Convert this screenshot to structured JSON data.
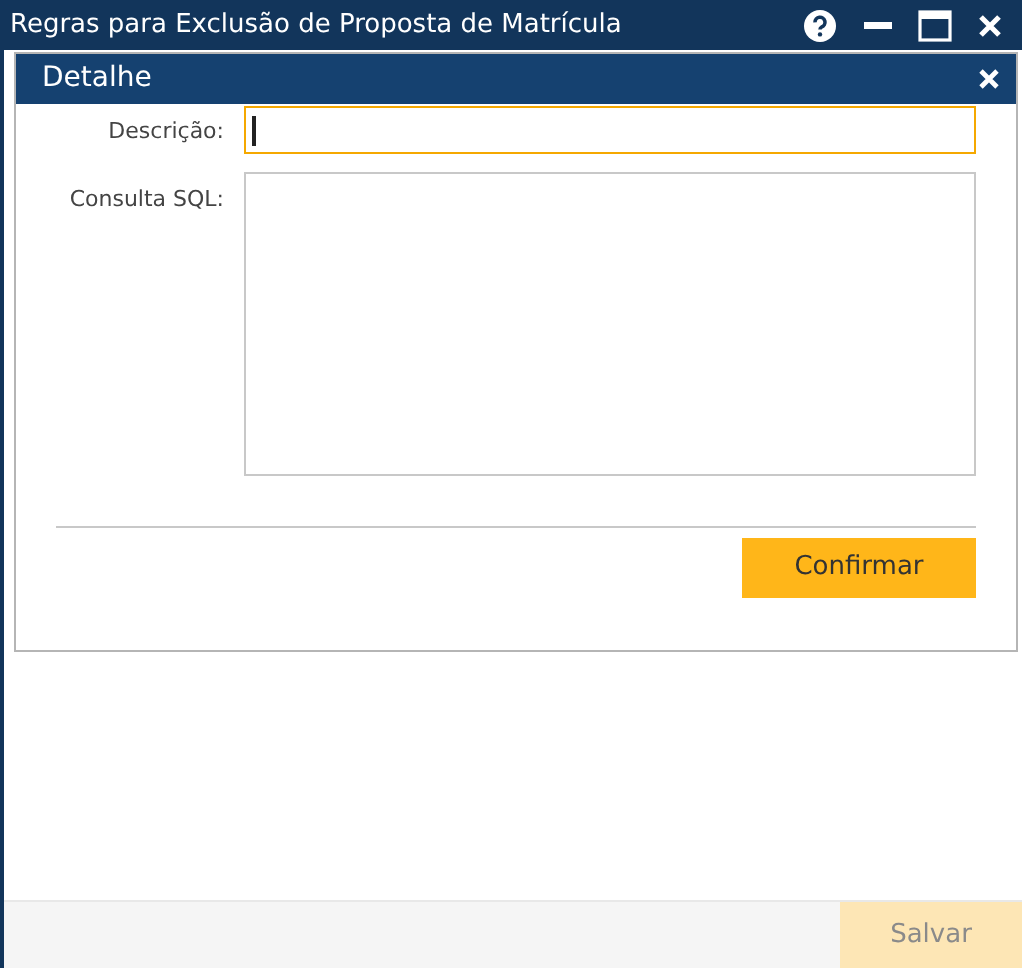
{
  "window": {
    "title": "Regras para Exclusão de Proposta de Matrícula"
  },
  "dialog": {
    "title": "Detalhe",
    "fields": [
      {
        "kind": "input",
        "label": "Descrição:",
        "focused": true
      },
      {
        "kind": "textarea",
        "label": "Consulta SQL:",
        "focused": false
      }
    ],
    "confirm_button": "Confirmar"
  },
  "footer": {
    "save_button": {
      "label": "Salvar",
      "disabled": true
    }
  }
}
